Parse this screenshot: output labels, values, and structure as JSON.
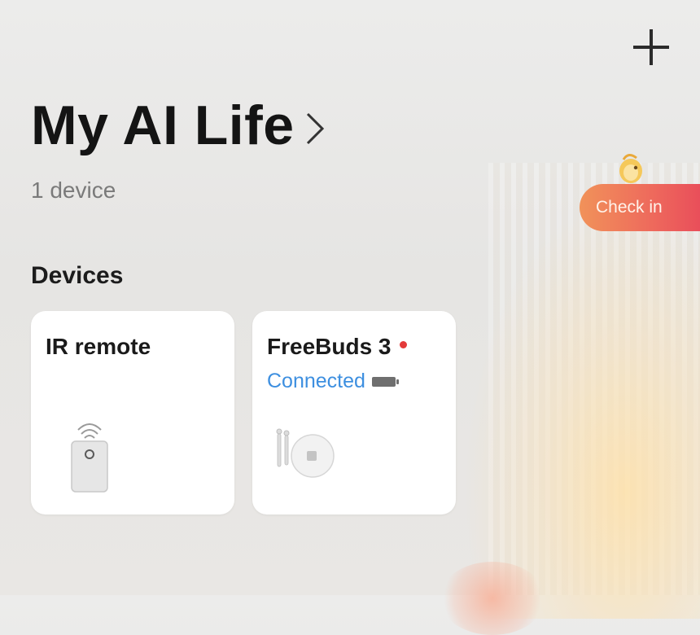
{
  "header": {
    "title": "My AI Life",
    "device_count": "1 device"
  },
  "checkin": {
    "label": "Check in"
  },
  "devices_section": {
    "label": "Devices",
    "cards": [
      {
        "name": "IR remote",
        "status": ""
      },
      {
        "name": "FreeBuds 3",
        "status": "Connected"
      }
    ]
  },
  "colors": {
    "status_connected": "#3d8fe0",
    "checkin_gradient_start": "#f1925a",
    "checkin_gradient_end": "#e8495a",
    "alert_dot": "#e33a3a"
  },
  "icons": {
    "add": "plus-icon",
    "title_chevron": "chevron-right-icon",
    "battery": "battery-icon",
    "mascot": "mascot-icon",
    "ir_remote": "ir-remote-icon",
    "earbuds": "earbuds-icon"
  }
}
